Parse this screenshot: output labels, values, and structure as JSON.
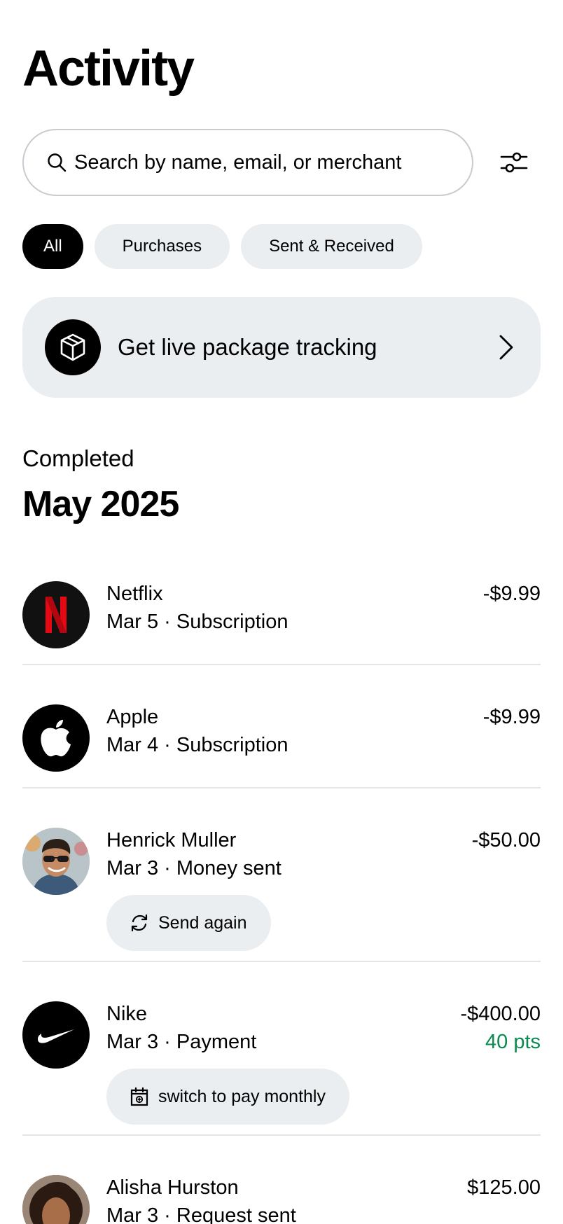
{
  "header": {
    "title": "Activity"
  },
  "search": {
    "placeholder": "Search by name, email, or merchant"
  },
  "filters": [
    {
      "label": "All",
      "active": true
    },
    {
      "label": "Purchases",
      "active": false
    },
    {
      "label": "Sent & Received",
      "active": false
    }
  ],
  "promo": {
    "label": "Get live package tracking",
    "icon": "package-icon"
  },
  "section": {
    "status": "Completed",
    "month": "May 2025"
  },
  "colors": {
    "points_green": "#0a8a50",
    "chip_bg": "#eaeef1",
    "netflix_red": "#e50914"
  },
  "transactions": [
    {
      "name": "Netflix",
      "meta": "Mar 5 · Subscription",
      "amount": "-$9.99",
      "icon": "netflix-logo"
    },
    {
      "name": "Apple",
      "meta": "Mar 4 · Subscription",
      "amount": "-$9.99",
      "icon": "apple-logo"
    },
    {
      "name": "Henrick Muller",
      "meta": "Mar 3 · Money sent",
      "amount": "-$50.00",
      "icon": "user-avatar",
      "action": "Send again",
      "action_icon": "refresh-icon"
    },
    {
      "name": "Nike",
      "meta": "Mar 3 · Payment",
      "amount": "-$400.00",
      "points": "40 pts",
      "icon": "nike-logo",
      "action": "switch to pay monthly",
      "action_icon": "calendar-icon"
    },
    {
      "name": "Alisha Hurston",
      "meta": "Mar 3 · Request sent",
      "amount": "$125.00",
      "icon": "user-avatar"
    }
  ]
}
